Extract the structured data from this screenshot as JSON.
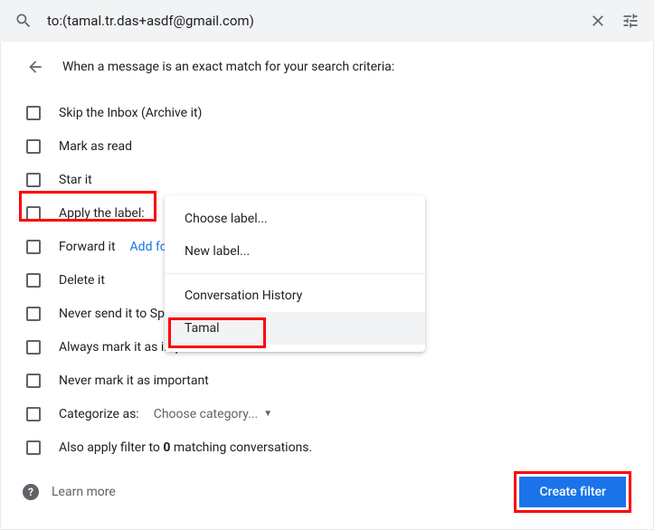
{
  "search": {
    "value": "to:(tamal.tr.das+asdf@gmail.com)"
  },
  "header": {
    "text": "When a message is an exact match for your search criteria:"
  },
  "options": {
    "skip_inbox": "Skip the Inbox (Archive it)",
    "mark_read": "Mark as read",
    "star_it": "Star it",
    "apply_label": "Apply the label:",
    "forward_it": "Forward it",
    "forward_link": "Add forwarding address",
    "delete_it": "Delete it",
    "never_spam": "Never send it to Spam",
    "always_important": "Always mark it as important",
    "never_important": "Never mark it as important",
    "categorize": "Categorize as:",
    "category_value": "Choose category...",
    "also_apply_prefix": "Also apply filter to ",
    "matching_count": "0",
    "also_apply_suffix": " matching conversations."
  },
  "label_dropdown": {
    "choose": "Choose label...",
    "new": "New label...",
    "item1": "Conversation History",
    "item2": "Tamal"
  },
  "footer": {
    "learn_more": "Learn more",
    "create_filter": "Create filter"
  }
}
